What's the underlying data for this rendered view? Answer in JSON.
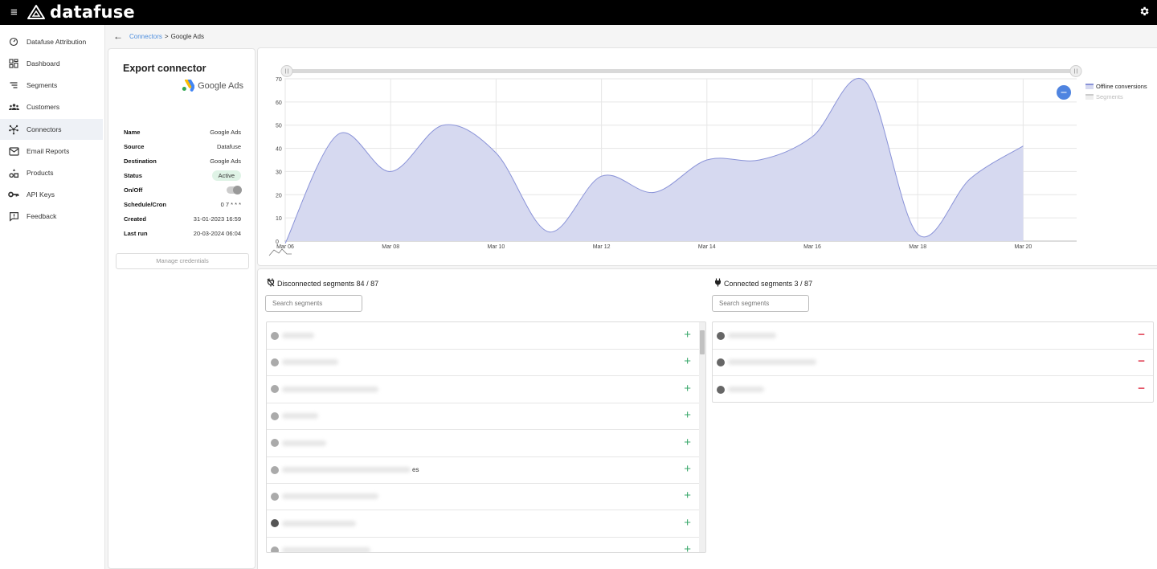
{
  "app": {
    "name": "datafuse"
  },
  "sidebar": {
    "items": [
      {
        "label": "Datafuse Attribution",
        "icon": "speedometer-icon",
        "active": false
      },
      {
        "label": "Dashboard",
        "icon": "dashboard-icon",
        "active": false
      },
      {
        "label": "Segments",
        "icon": "segments-icon",
        "active": false
      },
      {
        "label": "Customers",
        "icon": "customers-icon",
        "active": false
      },
      {
        "label": "Connectors",
        "icon": "connectors-icon",
        "active": true
      },
      {
        "label": "Email Reports",
        "icon": "email-icon",
        "active": false
      },
      {
        "label": "Products",
        "icon": "products-icon",
        "active": false
      },
      {
        "label": "API Keys",
        "icon": "key-icon",
        "active": false
      },
      {
        "label": "Feedback",
        "icon": "feedback-icon",
        "active": false
      }
    ]
  },
  "breadcrumb": {
    "link": "Connectors",
    "separator": ">",
    "current": "Google Ads"
  },
  "export_card": {
    "title": "Export connector",
    "logo_text": "Google Ads",
    "rows": {
      "name": {
        "label": "Name",
        "value": "Google Ads"
      },
      "source": {
        "label": "Source",
        "value": "Datafuse"
      },
      "destination": {
        "label": "Destination",
        "value": "Google Ads"
      },
      "status": {
        "label": "Status",
        "value": "Active"
      },
      "onoff": {
        "label": "On/Off"
      },
      "schedule": {
        "label": "Schedule/Cron",
        "value": "0 7 * * *"
      },
      "created": {
        "label": "Created",
        "value": "31-01-2023 16:59"
      },
      "last_run": {
        "label": "Last run",
        "value": "20-03-2024 06:04"
      }
    },
    "manage_label": "Manage credentials"
  },
  "chart_data": {
    "type": "area",
    "x": [
      "Mar 06",
      "Mar 07",
      "Mar 08",
      "Mar 09",
      "Mar 10",
      "Mar 11",
      "Mar 12",
      "Mar 13",
      "Mar 14",
      "Mar 15",
      "Mar 16",
      "Mar 17",
      "Mar 18",
      "Mar 19",
      "Mar 20"
    ],
    "x_ticks": [
      "Mar 06",
      "Mar 08",
      "Mar 10",
      "Mar 12",
      "Mar 14",
      "Mar 16",
      "Mar 18",
      "Mar 20"
    ],
    "y_ticks": [
      "0",
      "10",
      "20",
      "30",
      "40",
      "50",
      "60",
      "70"
    ],
    "ylim": [
      0,
      70
    ],
    "series": [
      {
        "name": "Offline conversions",
        "values": [
          -1,
          46,
          30,
          50,
          38,
          4,
          28,
          21,
          35,
          35,
          45,
          69,
          3,
          27,
          41
        ],
        "color": "#8a93d8",
        "fill": "#d6d9f0"
      },
      {
        "name": "Segments",
        "values": [],
        "color": "#cccccc"
      }
    ],
    "grid": true,
    "legend": "top-right"
  },
  "disconnected": {
    "title": "Disconnected segments 84 / 87",
    "search_placeholder": "Search segments",
    "partial_label": "es"
  },
  "connected": {
    "title": "Connected segments 3 / 87",
    "search_placeholder": "Search segments"
  }
}
